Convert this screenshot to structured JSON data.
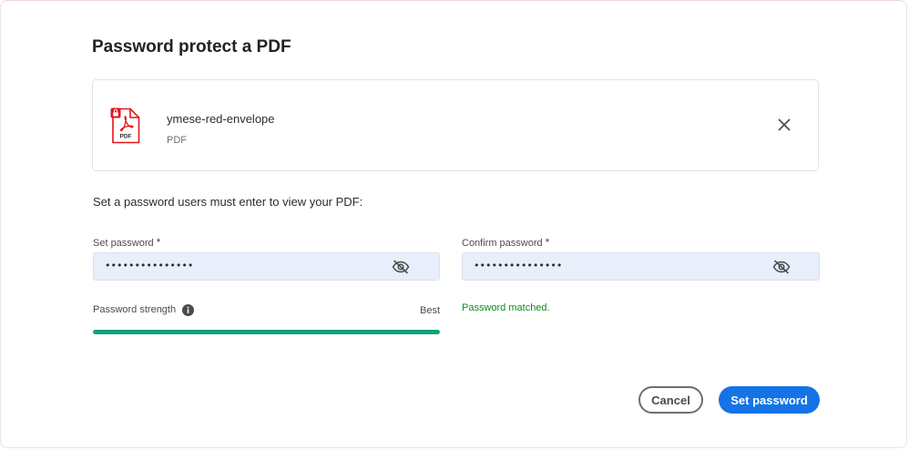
{
  "dialog": {
    "title": "Password protect a PDF"
  },
  "file": {
    "name": "ymese-red-envelope",
    "type": "PDF",
    "icon_label": "PDF",
    "icon": "pdf-file-locked-icon"
  },
  "instruction": "Set a password users must enter to view your PDF:",
  "set_password": {
    "label": "Set password",
    "required_marker": "*",
    "value": "•••••••••••••••",
    "visibility_icon": "eye-hidden-icon"
  },
  "confirm_password": {
    "label": "Confirm password",
    "required_marker": "*",
    "value": "•••••••••••••••",
    "visibility_icon": "eye-hidden-icon"
  },
  "strength": {
    "label": "Password strength",
    "info_icon": "info-icon",
    "value_label": "Best",
    "level": 1.0
  },
  "match_status": "Password matched.",
  "buttons": {
    "cancel": "Cancel",
    "submit": "Set password"
  },
  "colors": {
    "primary": "#1473e6",
    "strength_fill": "#12a07a",
    "success_text": "#0d8a1f",
    "pdf_red": "#e4141b",
    "field_bg": "#e8eefa"
  }
}
